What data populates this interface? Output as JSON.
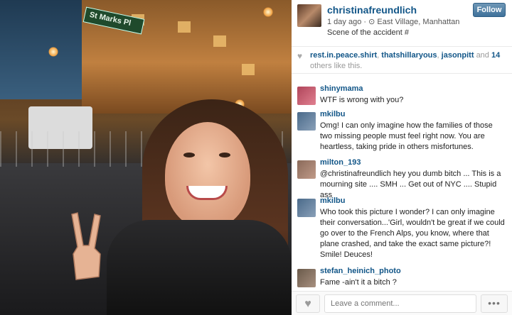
{
  "photo": {
    "street_sign": "St Marks Pl"
  },
  "post": {
    "username": "christinafreundlich",
    "time": "1 day ago",
    "location_icon": "location-pin-icon",
    "location": "East Village, Manhattan",
    "caption": "Scene of the accident #",
    "follow_label": "Follow"
  },
  "likes": {
    "icon": "heart-icon",
    "users": [
      "rest.in.peace.shirt",
      "thatshillaryous",
      "jasonpitt"
    ],
    "suffix_and": "and",
    "others_count": "14",
    "others_text": "others like this."
  },
  "comments": [
    {
      "username": "shinymama",
      "text": "WTF is wrong with you?",
      "avatar_color": "#b0455a"
    },
    {
      "username": "mkilbu",
      "text": "Omg! I can only imagine how the families of those two missing people must feel right now. You are heartless, taking pride in others misfortunes.",
      "avatar_color": "#4a6a8a"
    },
    {
      "username": "milton_193",
      "text": "@christinafreundlich hey you dumb bitch ... This is a mourning site .... SMH ... Get out of NYC .... Stupid ass",
      "avatar_color": "#8a6a5a"
    },
    {
      "username": "mkilbu",
      "text": "Who took this picture I wonder? I can only imagine their conversation...'Girl, wouldn't be great if we could go over to the French Alps, you know, where that plane crashed, and take the exact same picture?! Smile! Deuces!",
      "avatar_color": "#4a6a8a"
    },
    {
      "username": "stefan_heinich_photo",
      "text": "Fame -ain't it a bitch ?",
      "avatar_color": "#6a5a4a"
    }
  ],
  "footer": {
    "like_icon": "heart-icon",
    "comment_placeholder": "Leave a comment...",
    "more_icon": "ellipsis-icon",
    "more_label": "•••"
  }
}
